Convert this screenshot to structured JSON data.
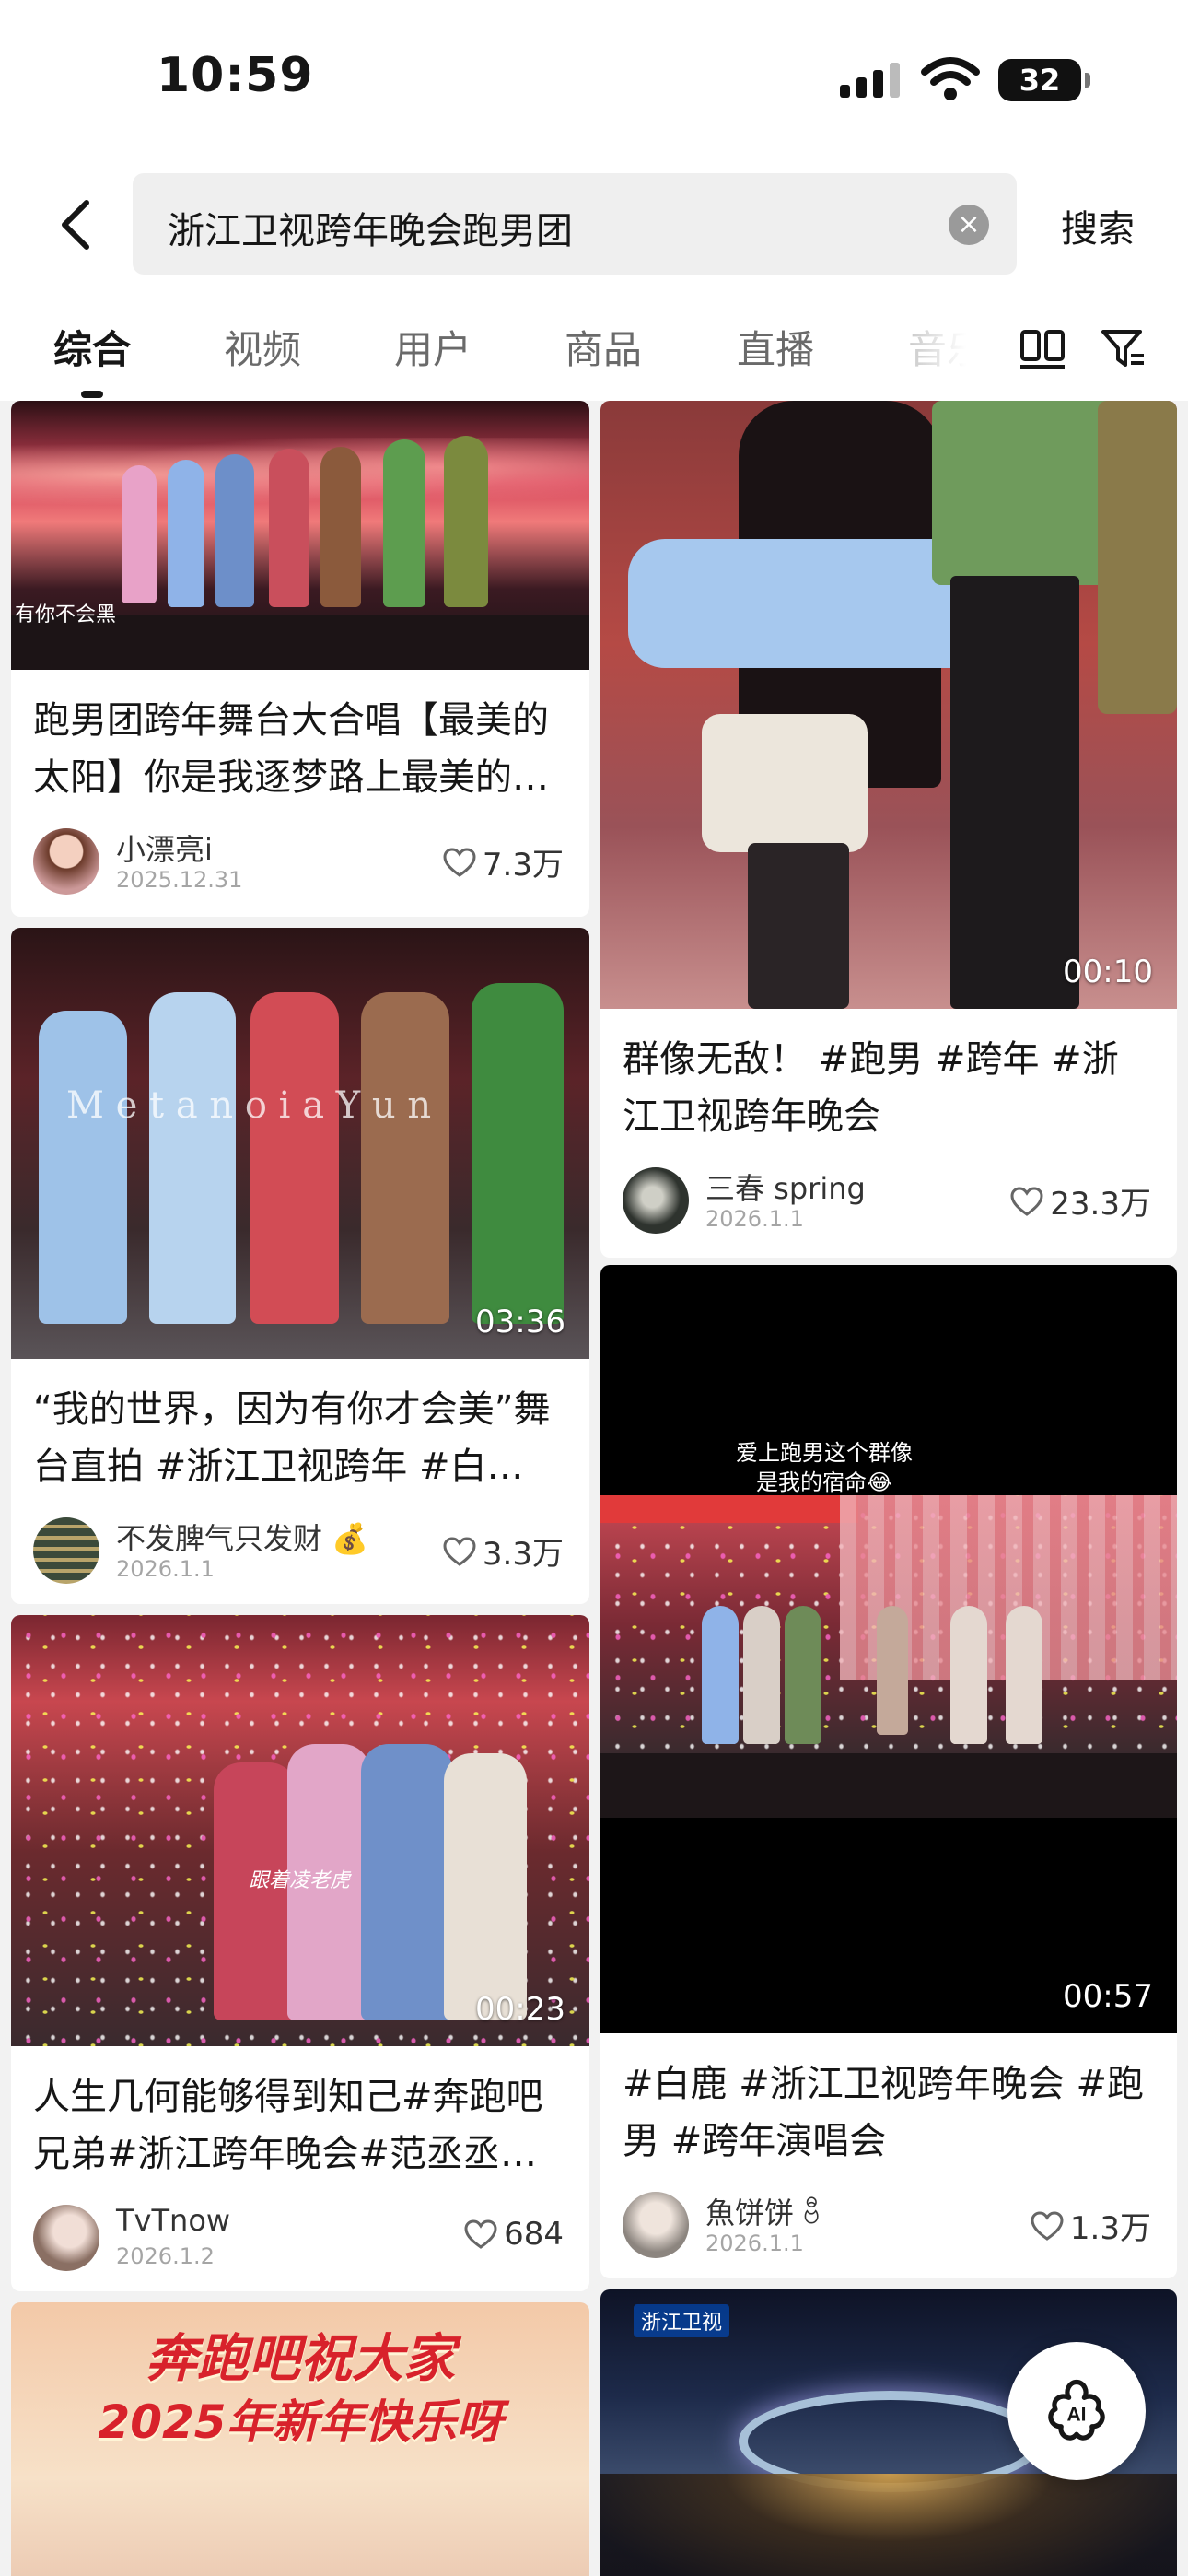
{
  "status": {
    "time": "10:59",
    "battery": "32"
  },
  "search": {
    "query": "浙江卫视跨年晚会跑男团",
    "button": "搜索"
  },
  "tabs": [
    {
      "label": "综合",
      "active": true
    },
    {
      "label": "视频"
    },
    {
      "label": "用户"
    },
    {
      "label": "商品"
    },
    {
      "label": "直播"
    },
    {
      "label": "音乐"
    }
  ],
  "icons": {
    "layout": "double-column-icon",
    "filter": "filter-icon",
    "ai": "ai-assistant-icon"
  },
  "left_column": [
    {
      "title": "跑男团跨年舞台大合唱【最美的太阳】你是我逐梦路上最美的…",
      "author": "小漂亮i",
      "date": "2025.12.31",
      "likes": "7.3万",
      "overlay_text": "有你不会黑"
    },
    {
      "title": "“我的世界，因为有你才会美”舞台直拍 #浙江卫视跨年 #白…",
      "author": "不发脾气只发财 💰",
      "date": "2026.1.1",
      "likes": "3.3万",
      "duration": "03:36",
      "watermark": "M e t a n o i a  Y u n"
    },
    {
      "title": "人生几何能够得到知己#奔跑吧兄弟#浙江跨年晚会#范丞丞#…",
      "author": "TvTnow",
      "date": "2026.1.2",
      "likes": "684",
      "duration": "00:23",
      "overlay_text": "跟着凌老虎"
    },
    {
      "banner_line1": "奔跑吧祝大家",
      "banner_line2": "2025年新年快乐呀"
    }
  ],
  "right_column": [
    {
      "title": "群像无敌！ #跑男 #跨年 #浙江卫视跨年晚会",
      "author": "三春 spring",
      "date": "2026.1.1",
      "likes": "23.3万",
      "duration": "00:10"
    },
    {
      "title": "#白鹿 #浙江卫视跨年晚会 #跑男 #跨年演唱会",
      "author": "魚饼饼 ဗီ",
      "date": "2026.1.1",
      "likes": "1.3万",
      "duration": "00:57",
      "caption_line1": "爱上跑男这个群像",
      "caption_line2": "是我的宿命😂"
    },
    {
      "channel": "浙江卫视"
    }
  ],
  "colors": {
    "accent": "#161616",
    "background": "#f2f2f2",
    "card": "#ffffff",
    "banner_text": "#d8222b"
  }
}
